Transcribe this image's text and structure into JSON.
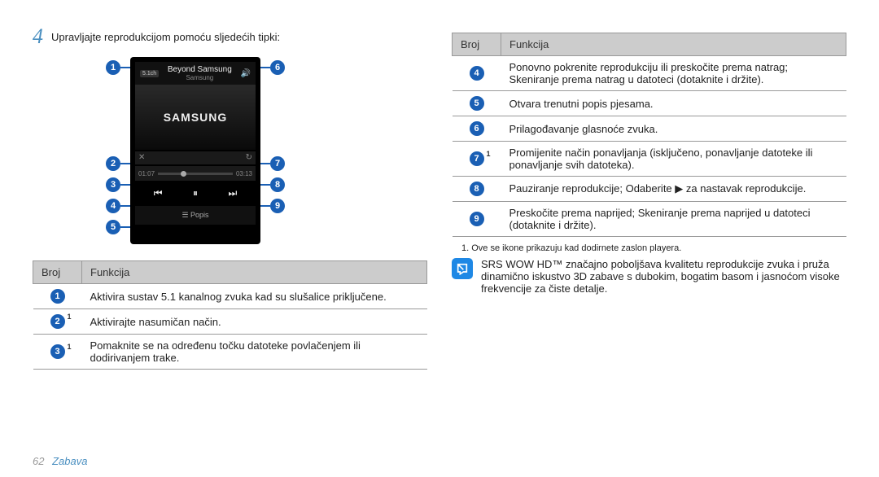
{
  "step": {
    "num": "4",
    "text": "Upravljajte reprodukcijom pomoću sljedećih tipki:"
  },
  "phone": {
    "badge": "5.1ch",
    "title": "Beyond Samsung",
    "subtitle": "Samsung",
    "album": "SAMSUNG",
    "prog_left": "01:07",
    "prog_right": "03:13",
    "bottom": "☰ Popis"
  },
  "table_left": {
    "h1": "Broj",
    "h2": "Funkcija",
    "rows": [
      {
        "n": "1",
        "sup": false,
        "d": "Aktivira sustav 5.1 kanalnog zvuka kad su slušalice priključene."
      },
      {
        "n": "2",
        "sup": true,
        "d": "Aktivirajte nasumičan način."
      },
      {
        "n": "3",
        "sup": true,
        "d": "Pomaknite se na određenu točku datoteke povlačenjem ili dodirivanjem trake."
      }
    ]
  },
  "table_right": {
    "h1": "Broj",
    "h2": "Funkcija",
    "rows": [
      {
        "n": "4",
        "sup": false,
        "d": "Ponovno pokrenite reprodukciju ili preskočite prema natrag; Skeniranje prema natrag u datoteci (dotaknite i držite)."
      },
      {
        "n": "5",
        "sup": false,
        "d": "Otvara trenutni popis pjesama."
      },
      {
        "n": "6",
        "sup": false,
        "d": "Prilagođavanje glasnoće zvuka."
      },
      {
        "n": "7",
        "sup": true,
        "d": "Promijenite način ponavljanja (isključeno, ponavljanje datoteke ili ponavljanje svih datoteka)."
      },
      {
        "n": "8",
        "sup": false,
        "d": "Pauziranje reprodukcije; Odaberite ▶ za nastavak reprodukcije."
      },
      {
        "n": "9",
        "sup": false,
        "d": "Preskočite prema naprijed; Skeniranje prema naprijed u datoteci (dotaknite i držite)."
      }
    ]
  },
  "footnote": "1. Ove se ikone prikazuju kad dodirnete zaslon playera.",
  "note": "SRS WOW HD™ značajno poboljšava kvalitetu reprodukcije zvuka i pruža dinamično iskustvo 3D zabave s dubokim, bogatim basom i jasnoćom visoke frekvencije za čiste detalje.",
  "footer": {
    "page": "62",
    "section": "Zabava"
  }
}
